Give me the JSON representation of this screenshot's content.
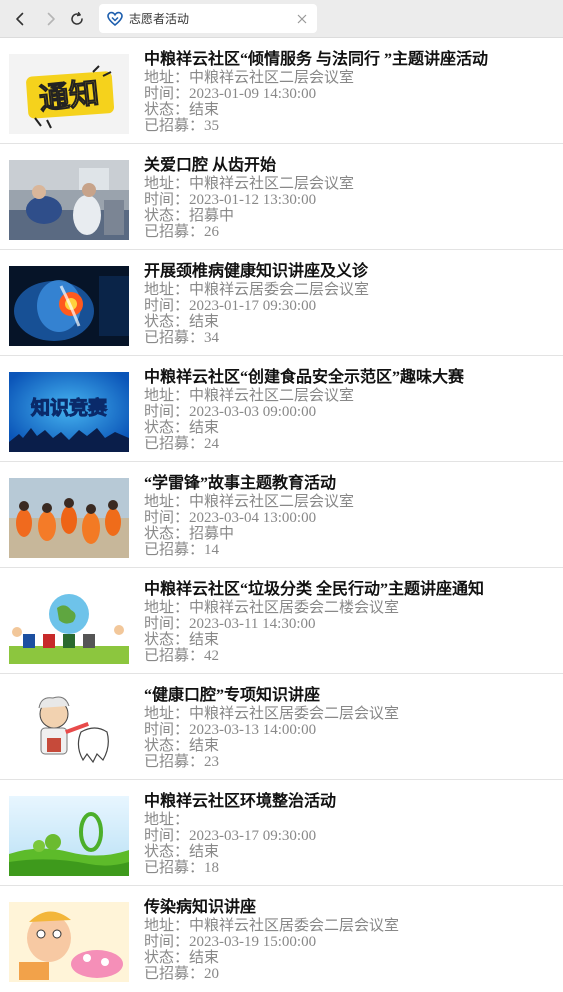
{
  "browser": {
    "tab_title": "志愿者活动"
  },
  "activities": [
    {
      "title": "中粮祥云社区“倾情服务 与法同行 ”主题讲座活动",
      "address": "地址：中粮祥云社区二层会议室",
      "time": "时间：2023-01-09 14:30:00",
      "status": "状态：结束",
      "recruited": "已招募：35",
      "thumb_text": "通知"
    },
    {
      "title": "关爱口腔 从齿开始",
      "address": "地址：中粮祥云社区二层会议室",
      "time": "时间：2023-01-12 13:30:00",
      "status": "状态：招募中",
      "recruited": "已招募：26",
      "thumb_text": ""
    },
    {
      "title": "开展颈椎病健康知识讲座及义诊",
      "address": "地址：中粮祥云居委会二层会议室",
      "time": "时间：2023-01-17 09:30:00",
      "status": "状态：结束",
      "recruited": "已招募：34",
      "thumb_text": ""
    },
    {
      "title": "中粮祥云社区“创建食品安全示范区”趣味大赛",
      "address": "地址：中粮祥云社区二层会议室",
      "time": "时间：2023-03-03 09:00:00",
      "status": "状态：结束",
      "recruited": "已招募：24",
      "thumb_text": "知识竞赛"
    },
    {
      "title": "“学雷锋”故事主题教育活动",
      "address": "地址：中粮祥云社区二层会议室",
      "time": "时间：2023-03-04 13:00:00",
      "status": "状态：招募中",
      "recruited": "已招募：14",
      "thumb_text": ""
    },
    {
      "title": "中粮祥云社区“垃圾分类 全民行动”主题讲座通知",
      "address": "地址：中粮祥云社区居委会二楼会议室",
      "time": "时间：2023-03-11 14:30:00",
      "status": "状态：结束",
      "recruited": "已招募：42",
      "thumb_text": ""
    },
    {
      "title": "“健康口腔”专项知识讲座",
      "address": "地址：中粮祥云社区居委会二层会议室",
      "time": "时间：2023-03-13 14:00:00",
      "status": "状态：结束",
      "recruited": "已招募：23",
      "thumb_text": ""
    },
    {
      "title": "中粮祥云社区环境整治活动",
      "address": "地址：",
      "time": "时间：2023-03-17 09:30:00",
      "status": "状态：结束",
      "recruited": "已招募：18",
      "thumb_text": ""
    },
    {
      "title": "传染病知识讲座",
      "address": "地址：中粮祥云社区居委会二层会议室",
      "time": "时间：2023-03-19 15:00:00",
      "status": "状态：结束",
      "recruited": "已招募：20",
      "thumb_text": ""
    }
  ]
}
